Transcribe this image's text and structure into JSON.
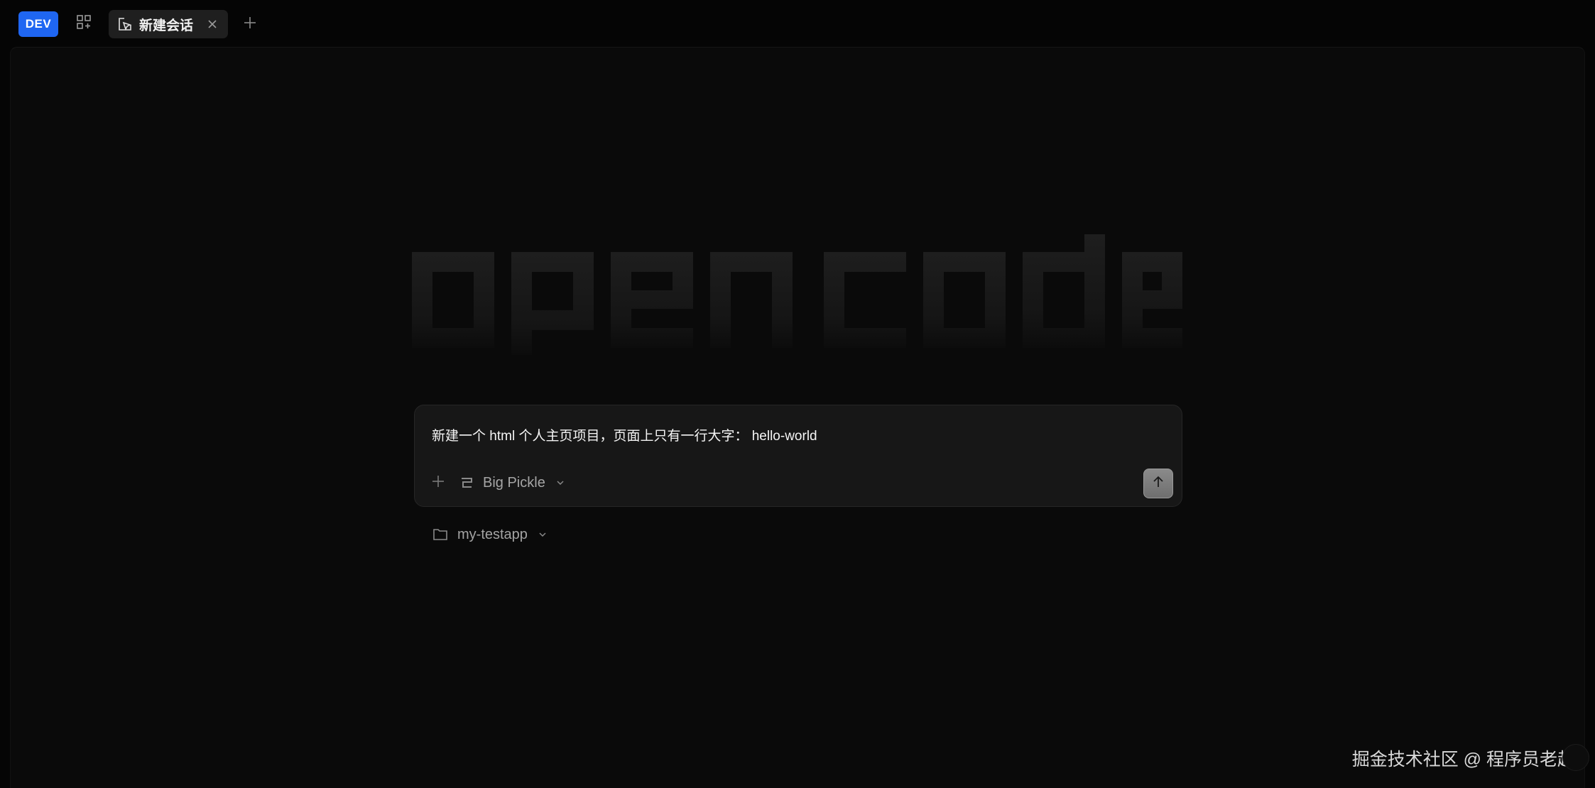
{
  "topbar": {
    "badge": "DEV",
    "tab_label": "新建会话"
  },
  "prompt": {
    "text": "新建一个 html 个人主页项目，页面上只有一行大字： hello-world",
    "model_label": "Big Pickle"
  },
  "project": {
    "name": "my-testapp"
  },
  "watermark": "掘金技术社区 @ 程序员老赵",
  "logo": {
    "word": "opencode"
  },
  "colors": {
    "accent": "#1f66f2",
    "background": "#0a0a0a",
    "prompt_bg": "#171717",
    "send_button": "#7a7a7a"
  },
  "icons": {
    "grid": "grid-add-icon",
    "tab": "cursor-window-icon",
    "close": "close-icon",
    "new_tab": "plus-icon",
    "attach": "plus-icon",
    "model": "model-z-icon",
    "send": "arrow-up-icon",
    "folder": "folder-icon",
    "chevron": "chevron-down-icon"
  }
}
